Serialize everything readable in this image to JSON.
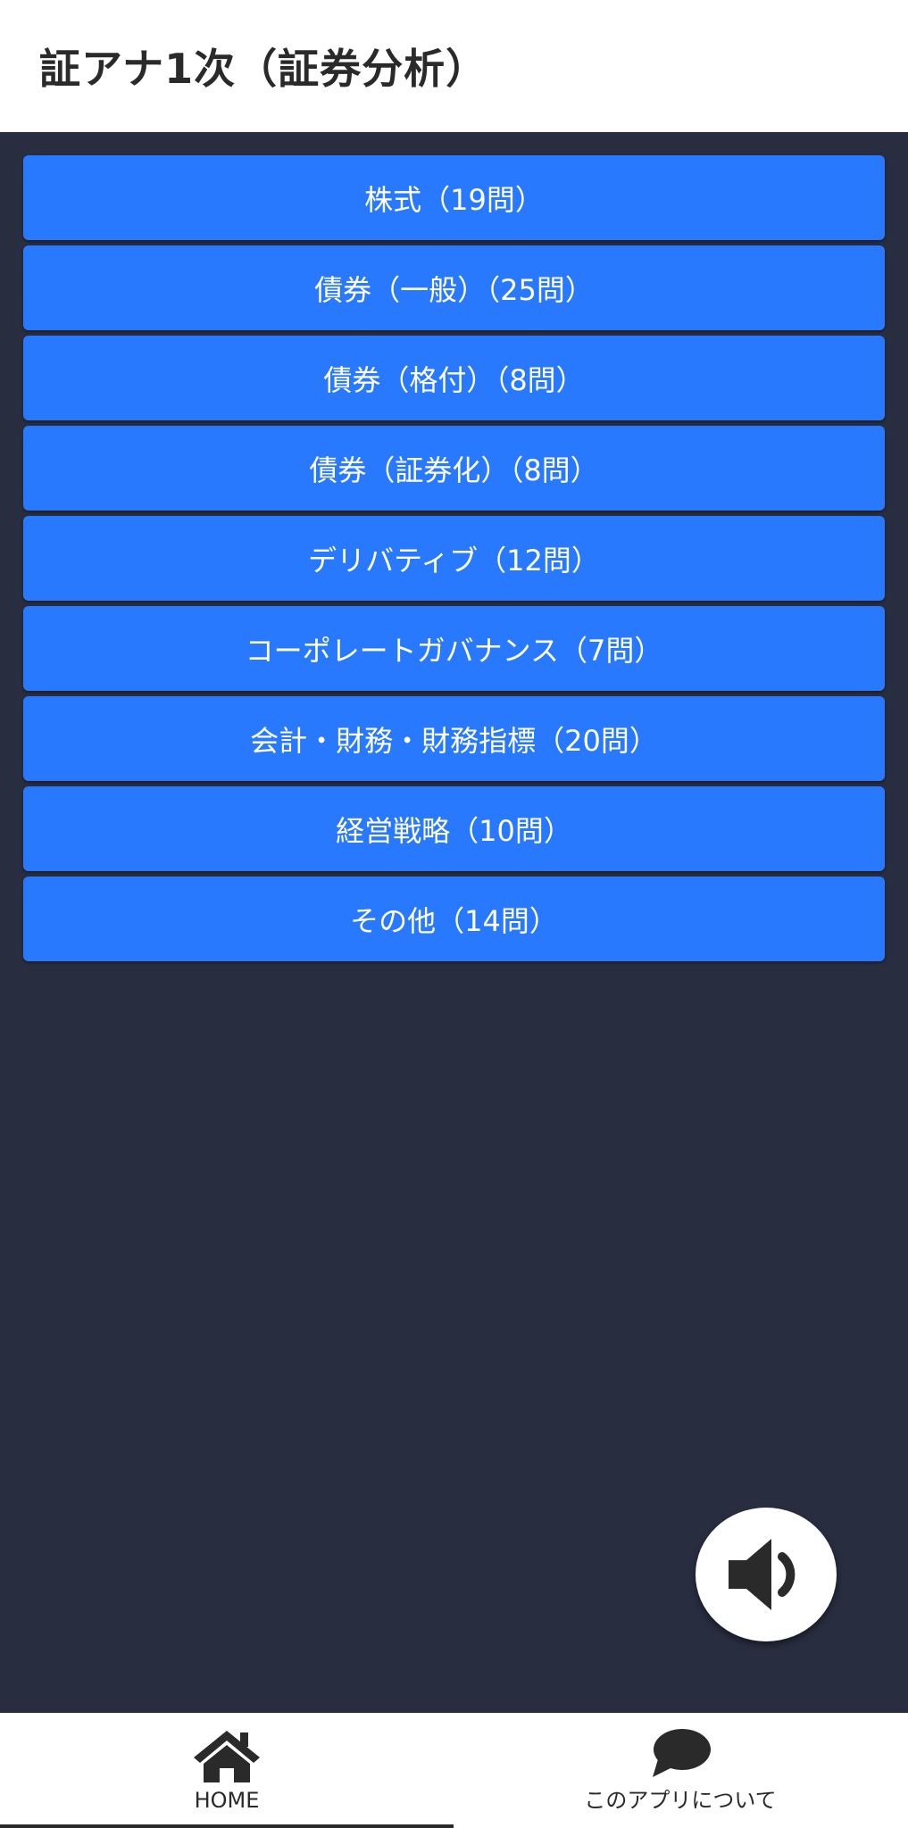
{
  "header": {
    "title": "証アナ1次（証券分析）"
  },
  "categories": [
    {
      "label": "株式（19問）"
    },
    {
      "label": "債券（一般）（25問）"
    },
    {
      "label": "債券（格付）（8問）"
    },
    {
      "label": "債券（証券化）（8問）"
    },
    {
      "label": "デリバティブ（12問）"
    },
    {
      "label": "コーポレートガバナンス（7問）"
    },
    {
      "label": "会計・財務・財務指標（20問）"
    },
    {
      "label": "経営戦略（10問）"
    },
    {
      "label": "その他（14問）"
    }
  ],
  "sound": {
    "icon": "speaker-icon"
  },
  "bottom_nav": {
    "home": {
      "label": "HOME",
      "icon": "home-icon"
    },
    "about": {
      "label": "このアプリについて",
      "icon": "chat-bubble-icon"
    }
  },
  "colors": {
    "header_bg": "#ffffff",
    "background": "#282d40",
    "button": "#2979ff",
    "nav_bg": "#ffffff",
    "icon": "#2a2a2a"
  }
}
